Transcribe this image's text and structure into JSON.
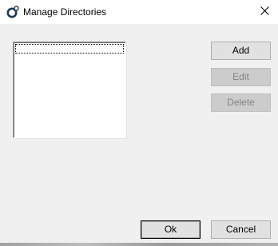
{
  "window": {
    "title": "Manage Directories",
    "app_icon": "app-logo-icon",
    "close_icon": "close-icon"
  },
  "directories": {
    "items": []
  },
  "buttons": {
    "add": "Add",
    "edit": "Edit",
    "delete": "Delete",
    "ok": "Ok",
    "cancel": "Cancel"
  },
  "state": {
    "edit_enabled": false,
    "delete_enabled": false,
    "default_button": "ok"
  },
  "colors": {
    "face": "#f0f0f0",
    "button": "#e1e1e1",
    "disabled_text": "#838383",
    "title_bar": "#ffffff"
  }
}
